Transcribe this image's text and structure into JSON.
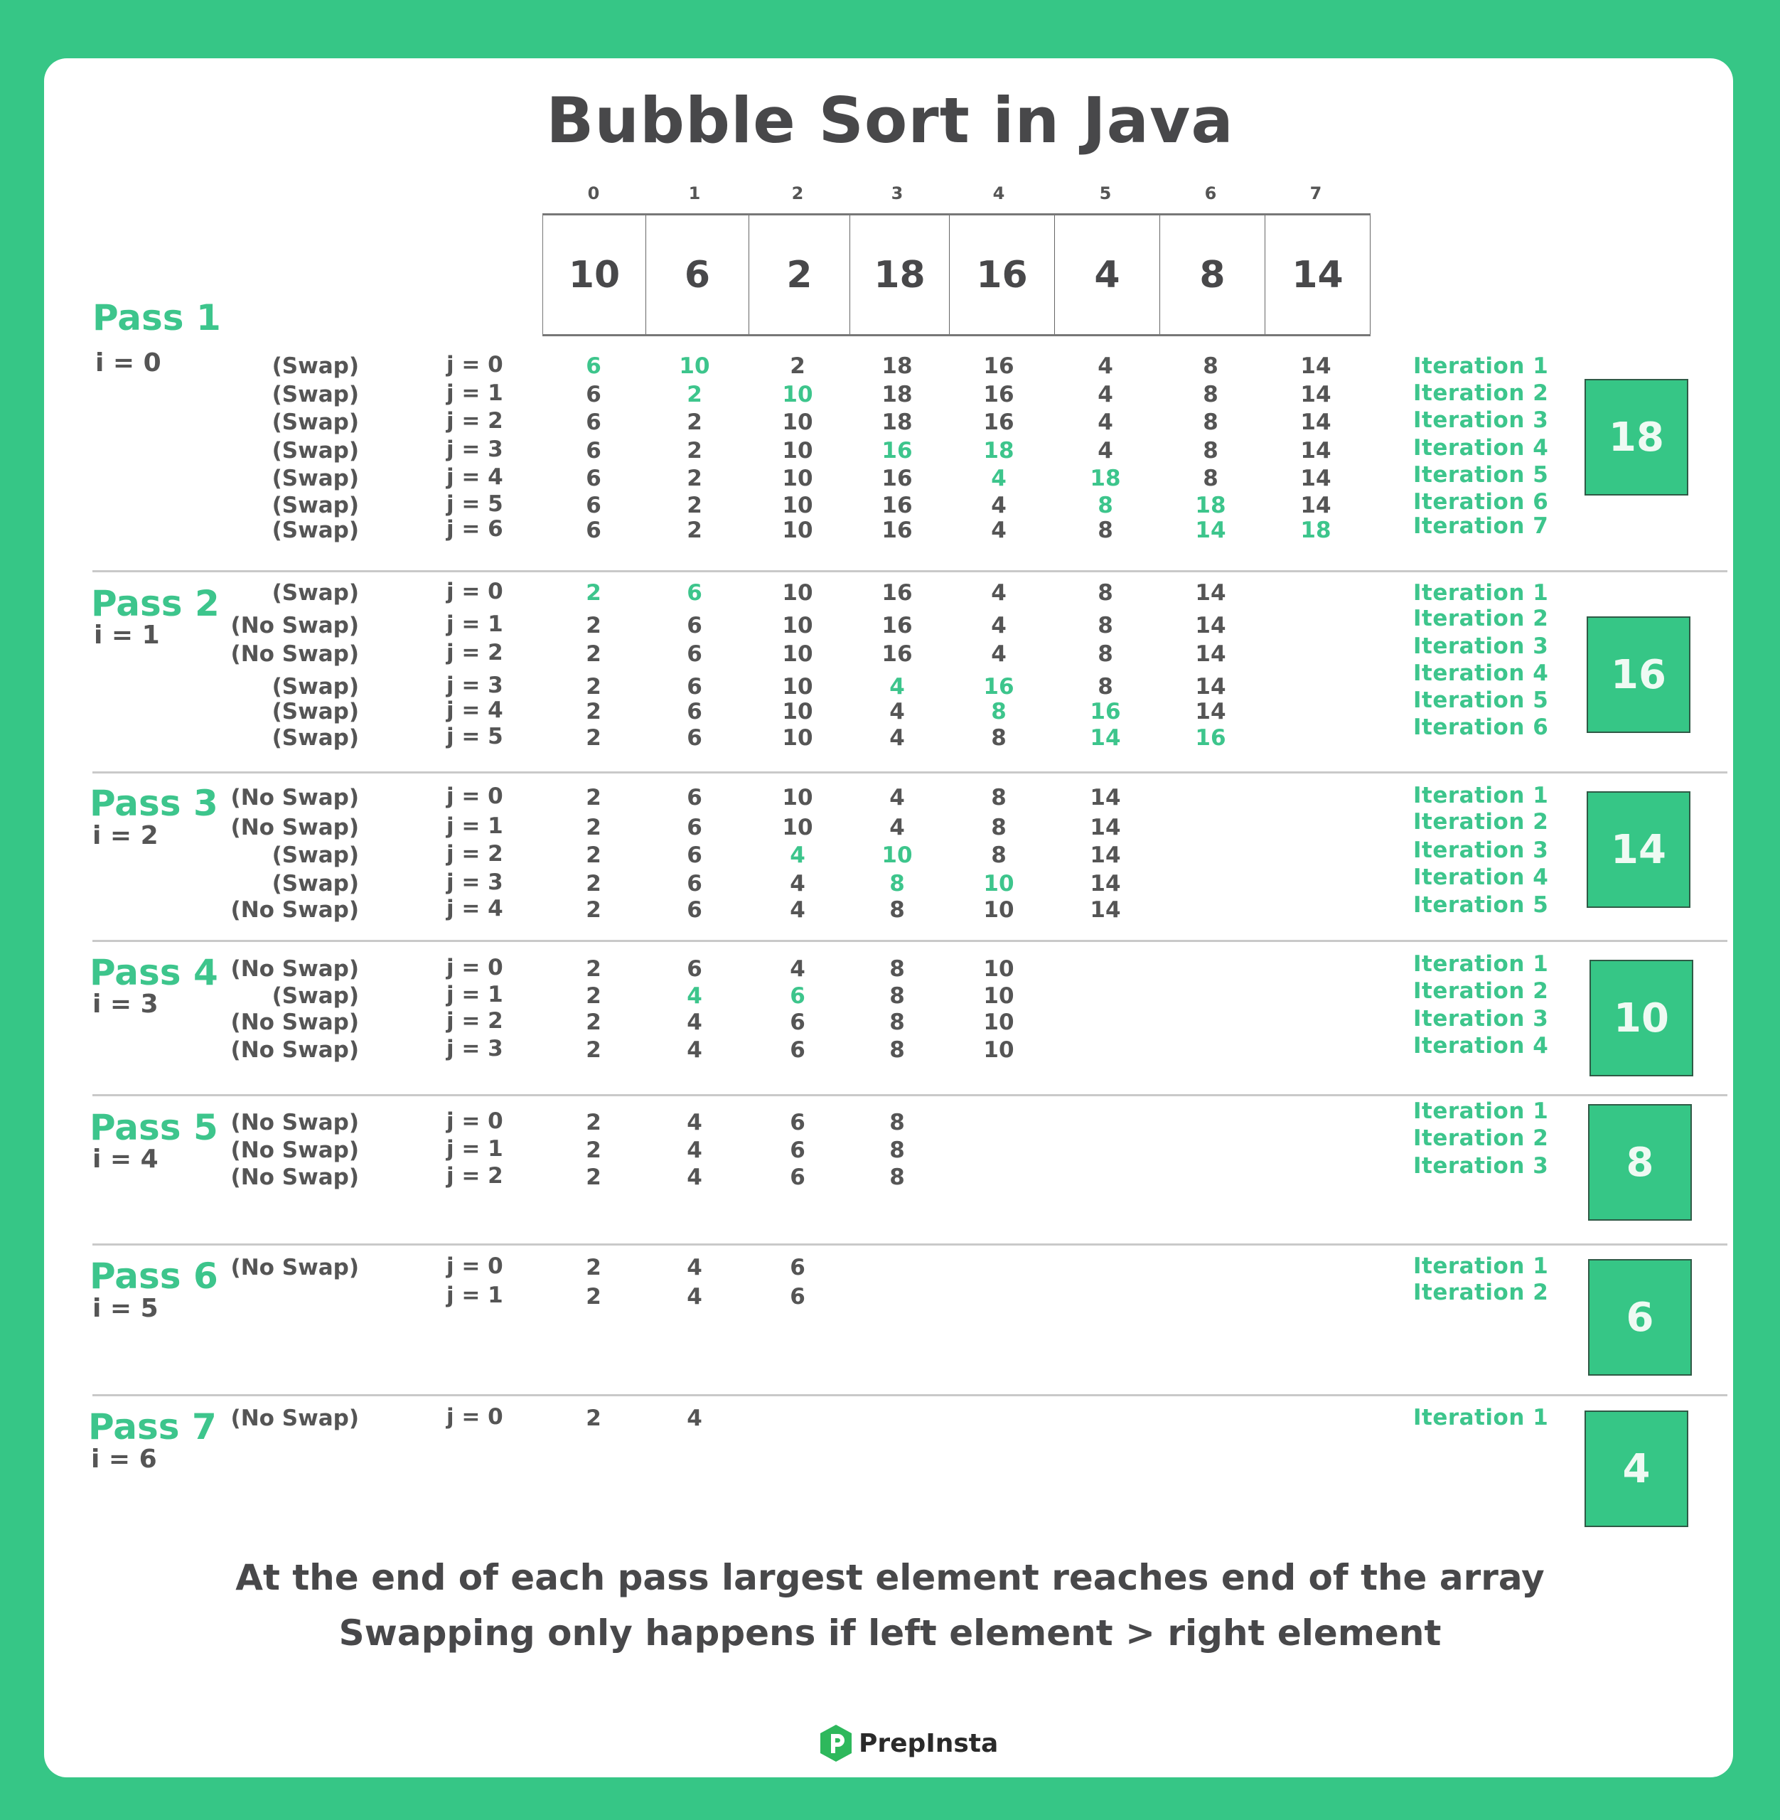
{
  "title": "Bubble Sort in Java",
  "colors": {
    "accent": "#3DC58C",
    "background": "#36C686",
    "text": "#48484A",
    "result_box": "#36C686"
  },
  "initial_array": {
    "indices": [
      "0",
      "1",
      "2",
      "3",
      "4",
      "5",
      "6",
      "7"
    ],
    "values": [
      "10",
      "6",
      "2",
      "18",
      "16",
      "4",
      "8",
      "14"
    ]
  },
  "passes": [
    {
      "label": "Pass 1",
      "i_label": "i = 0",
      "result": "18",
      "rows": [
        {
          "swap": "(Swap)",
          "j": "j = 0",
          "values": [
            "6",
            "10",
            "2",
            "18",
            "16",
            "4",
            "8",
            "14"
          ],
          "highlight": [
            0,
            1
          ]
        },
        {
          "swap": "(Swap)",
          "j": "j = 1",
          "values": [
            "6",
            "2",
            "10",
            "18",
            "16",
            "4",
            "8",
            "14"
          ],
          "highlight": [
            1,
            2
          ]
        },
        {
          "swap": "(Swap)",
          "j": "j = 2",
          "values": [
            "6",
            "2",
            "10",
            "18",
            "16",
            "4",
            "8",
            "14"
          ],
          "highlight": []
        },
        {
          "swap": "(Swap)",
          "j": "j = 3",
          "values": [
            "6",
            "2",
            "10",
            "16",
            "18",
            "4",
            "8",
            "14"
          ],
          "highlight": [
            3,
            4
          ]
        },
        {
          "swap": "(Swap)",
          "j": "j = 4",
          "values": [
            "6",
            "2",
            "10",
            "16",
            "4",
            "18",
            "8",
            "14"
          ],
          "highlight": [
            4,
            5
          ]
        },
        {
          "swap": "(Swap)",
          "j": "j = 5",
          "values": [
            "6",
            "2",
            "10",
            "16",
            "4",
            "8",
            "18",
            "14"
          ],
          "highlight": [
            5,
            6
          ]
        },
        {
          "swap": "(Swap)",
          "j": "j = 6",
          "values": [
            "6",
            "2",
            "10",
            "16",
            "4",
            "8",
            "14",
            "18"
          ],
          "highlight": [
            6,
            7
          ]
        }
      ],
      "iterations": [
        "Iteration 1",
        "Iteration 2",
        "Iteration 3",
        "Iteration 4",
        "Iteration 5",
        "Iteration 6",
        "Iteration 7"
      ]
    },
    {
      "label": "Pass 2",
      "i_label": "i = 1",
      "result": "16",
      "rows": [
        {
          "swap": "(Swap)",
          "j": "j = 0",
          "values": [
            "2",
            "6",
            "10",
            "16",
            "4",
            "8",
            "14"
          ],
          "highlight": [
            0,
            1
          ]
        },
        {
          "swap": "(No Swap)",
          "j": "j = 1",
          "values": [
            "2",
            "6",
            "10",
            "16",
            "4",
            "8",
            "14"
          ],
          "highlight": []
        },
        {
          "swap": "(No Swap)",
          "j": "j = 2",
          "values": [
            "2",
            "6",
            "10",
            "16",
            "4",
            "8",
            "14"
          ],
          "highlight": []
        },
        {
          "swap": "(Swap)",
          "j": "j = 3",
          "values": [
            "2",
            "6",
            "10",
            "4",
            "16",
            "8",
            "14"
          ],
          "highlight": [
            3,
            4
          ]
        },
        {
          "swap": "(Swap)",
          "j": "j = 4",
          "values": [
            "2",
            "6",
            "10",
            "4",
            "8",
            "16",
            "14"
          ],
          "highlight": [
            4,
            5
          ]
        },
        {
          "swap": "(Swap)",
          "j": "j = 5",
          "values": [
            "2",
            "6",
            "10",
            "4",
            "8",
            "14",
            "16"
          ],
          "highlight": [
            5,
            6
          ]
        }
      ],
      "iterations": [
        "Iteration 1",
        "Iteration 2",
        "Iteration 3",
        "Iteration 4",
        "Iteration 5",
        "Iteration 6"
      ]
    },
    {
      "label": "Pass 3",
      "i_label": "i = 2",
      "result": "14",
      "rows": [
        {
          "swap": "(No Swap)",
          "j": "j = 0",
          "values": [
            "2",
            "6",
            "10",
            "4",
            "8",
            "14"
          ],
          "highlight": []
        },
        {
          "swap": "(No Swap)",
          "j": "j = 1",
          "values": [
            "2",
            "6",
            "10",
            "4",
            "8",
            "14"
          ],
          "highlight": []
        },
        {
          "swap": "(Swap)",
          "j": "j = 2",
          "values": [
            "2",
            "6",
            "4",
            "10",
            "8",
            "14"
          ],
          "highlight": [
            2,
            3
          ]
        },
        {
          "swap": "(Swap)",
          "j": "j = 3",
          "values": [
            "2",
            "6",
            "4",
            "8",
            "10",
            "14"
          ],
          "highlight": [
            3,
            4
          ]
        },
        {
          "swap": "(No Swap)",
          "j": "j = 4",
          "values": [
            "2",
            "6",
            "4",
            "8",
            "10",
            "14"
          ],
          "highlight": []
        }
      ],
      "iterations": [
        "Iteration 1",
        "Iteration 2",
        "Iteration 3",
        "Iteration 4",
        "Iteration 5"
      ]
    },
    {
      "label": "Pass 4",
      "i_label": "i = 3",
      "result": "10",
      "rows": [
        {
          "swap": "(No Swap)",
          "j": "j = 0",
          "values": [
            "2",
            "6",
            "4",
            "8",
            "10"
          ],
          "highlight": []
        },
        {
          "swap": "(Swap)",
          "j": "j = 1",
          "values": [
            "2",
            "4",
            "6",
            "8",
            "10"
          ],
          "highlight": [
            1,
            2
          ]
        },
        {
          "swap": "(No Swap)",
          "j": "j = 2",
          "values": [
            "2",
            "4",
            "6",
            "8",
            "10"
          ],
          "highlight": []
        },
        {
          "swap": "(No Swap)",
          "j": "j = 3",
          "values": [
            "2",
            "4",
            "6",
            "8",
            "10"
          ],
          "highlight": []
        }
      ],
      "iterations": [
        "Iteration 1",
        "Iteration 2",
        "Iteration 3",
        "Iteration 4"
      ]
    },
    {
      "label": "Pass 5",
      "i_label": "i = 4",
      "result": "8",
      "rows": [
        {
          "swap": "(No Swap)",
          "j": "j = 0",
          "values": [
            "2",
            "4",
            "6",
            "8"
          ],
          "highlight": []
        },
        {
          "swap": "(No Swap)",
          "j": "j = 1",
          "values": [
            "2",
            "4",
            "6",
            "8"
          ],
          "highlight": []
        },
        {
          "swap": "(No Swap)",
          "j": "j = 2",
          "values": [
            "2",
            "4",
            "6",
            "8"
          ],
          "highlight": []
        }
      ],
      "iterations": [
        "Iteration 1",
        "Iteration 2",
        "Iteration 3"
      ]
    },
    {
      "label": "Pass 6",
      "i_label": "i = 5",
      "result": "6",
      "rows": [
        {
          "swap": "(No Swap)",
          "j": "j = 0",
          "values": [
            "2",
            "4",
            "6"
          ],
          "highlight": []
        },
        {
          "swap": "",
          "j": "j = 1",
          "values": [
            "2",
            "4",
            "6"
          ],
          "highlight": []
        }
      ],
      "iterations": [
        "Iteration 1",
        "Iteration 2"
      ]
    },
    {
      "label": "Pass 7",
      "i_label": "i = 6",
      "result": "4",
      "rows": [
        {
          "swap": "(No Swap)",
          "j": "j = 0",
          "values": [
            "2",
            "4"
          ],
          "highlight": []
        }
      ],
      "iterations": [
        "Iteration 1"
      ]
    }
  ],
  "notes": [
    "At the end of each pass largest element reaches end of the array",
    "Swapping only happens if left element > right element"
  ],
  "logo": {
    "text": "PrepInsta",
    "icon": "prepinsta-logo-icon"
  }
}
